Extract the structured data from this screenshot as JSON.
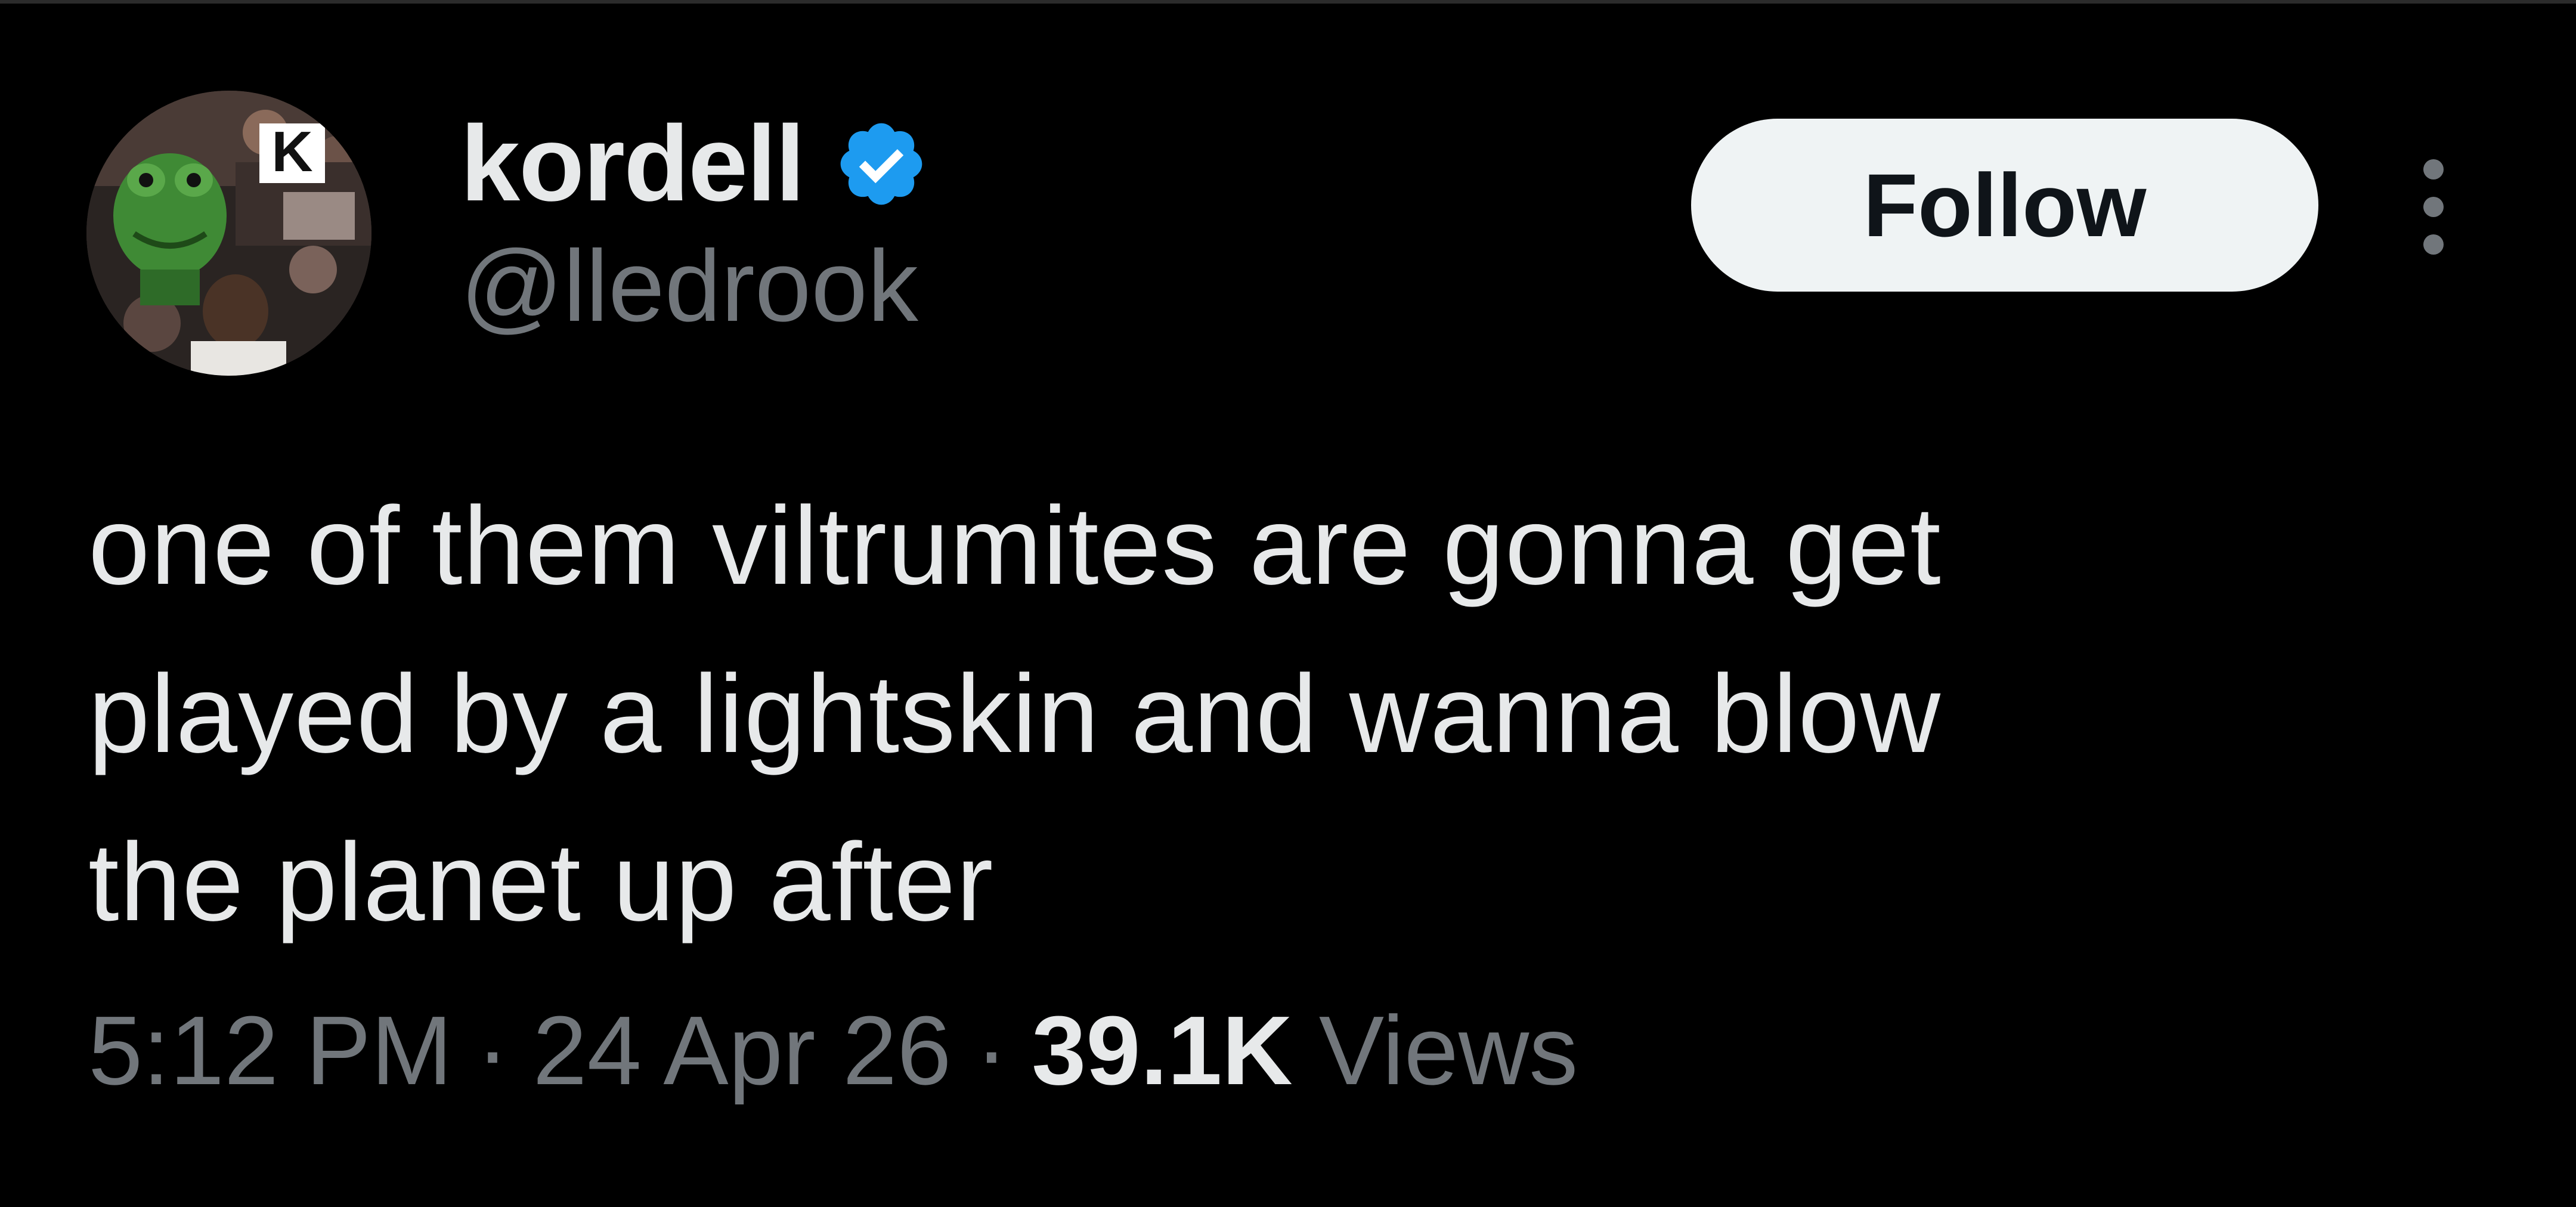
{
  "user": {
    "display_name": "kordell",
    "handle": "@lledrook",
    "verified": true,
    "avatar_badge_letter": "K"
  },
  "actions": {
    "follow_label": "Follow",
    "more_icon": "more-vertical-icon"
  },
  "tweet": {
    "lines": [
      "one of them viltrumites are gonna get",
      "played by a lightskin and wanna blow",
      "the planet up after"
    ]
  },
  "meta": {
    "time": "5:12 PM",
    "separator": "·",
    "date": "24 Apr 26",
    "views_count": "39.1K",
    "views_label": "Views"
  },
  "colors": {
    "background": "#000000",
    "text_primary": "#e7e9ea",
    "text_secondary": "#71767b",
    "verified_blue": "#1d9bf0",
    "follow_bg": "#eff3f4"
  }
}
